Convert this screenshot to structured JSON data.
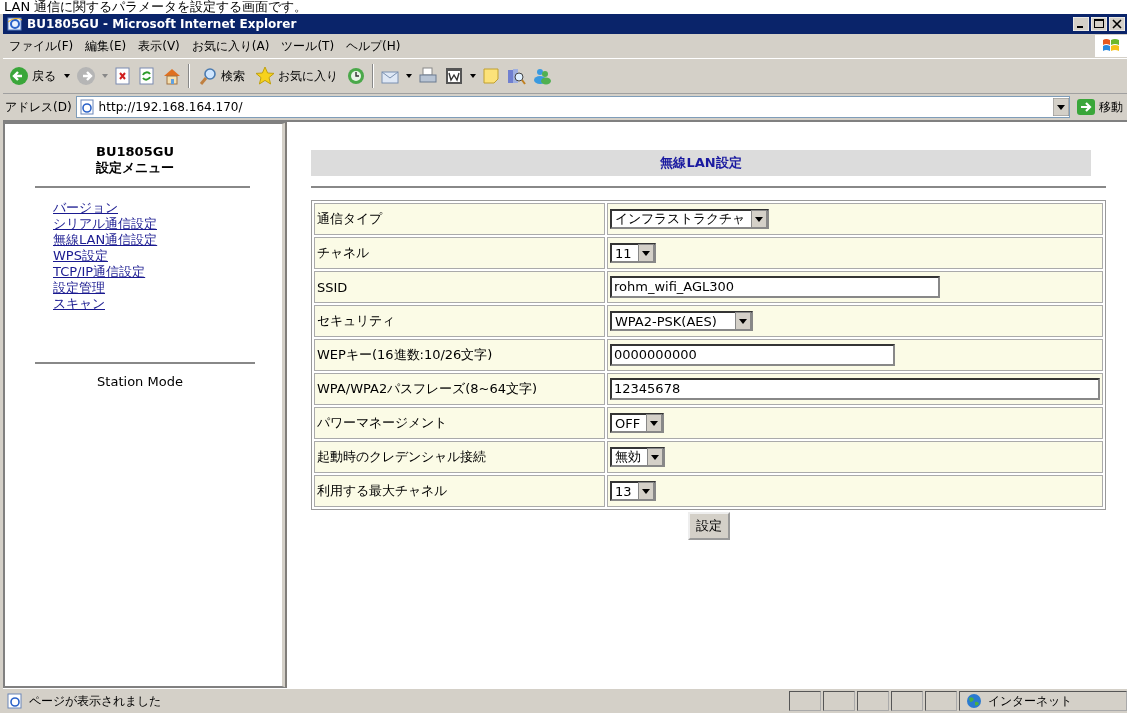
{
  "caption": "LAN 通信に関するパラメータを設定する画面です。",
  "window": {
    "title": "BU1805GU - Microsoft Internet Explorer"
  },
  "menu": [
    "ファイル(F)",
    "編集(E)",
    "表示(V)",
    "お気に入り(A)",
    "ツール(T)",
    "ヘルプ(H)"
  ],
  "toolbar": {
    "back": "戻る",
    "search": "検索",
    "favorites": "お気に入り"
  },
  "address": {
    "label": "アドレス(D)",
    "value": "http://192.168.164.170/",
    "go": "移動"
  },
  "sidebar": {
    "title": [
      "BU1805GU",
      "設定メニュー"
    ],
    "links": [
      "バージョン",
      "シリアル通信設定",
      "無線LAN通信設定",
      "WPS設定",
      "TCP/IP通信設定",
      "設定管理",
      "スキャン"
    ],
    "mode": "Station Mode"
  },
  "main": {
    "heading": "無線LAN設定",
    "rows": [
      {
        "label": "通信タイプ",
        "kind": "select",
        "value": "インフラストラクチャ"
      },
      {
        "label": "チャネル",
        "kind": "select",
        "value": "11"
      },
      {
        "label": "SSID",
        "kind": "text",
        "value": "rohm_wifi_AGL300"
      },
      {
        "label": "セキュリティ",
        "kind": "select",
        "value": "WPA2-PSK(AES)   "
      },
      {
        "label": "WEPキー(16進数:10/26文字)",
        "kind": "text",
        "value": "0000000000"
      },
      {
        "label": "WPA/WPA2パスフレーズ(8~64文字)",
        "kind": "text",
        "value": "12345678"
      },
      {
        "label": "パワーマネージメント",
        "kind": "select",
        "value": "OFF"
      },
      {
        "label": "起動時のクレデンシャル接続",
        "kind": "select",
        "value": "無効"
      },
      {
        "label": "利用する最大チャネル",
        "kind": "select",
        "value": "13"
      }
    ],
    "button": "設定"
  },
  "status_bar": {
    "text": "ページが表示されました",
    "zone": "インターネット"
  }
}
